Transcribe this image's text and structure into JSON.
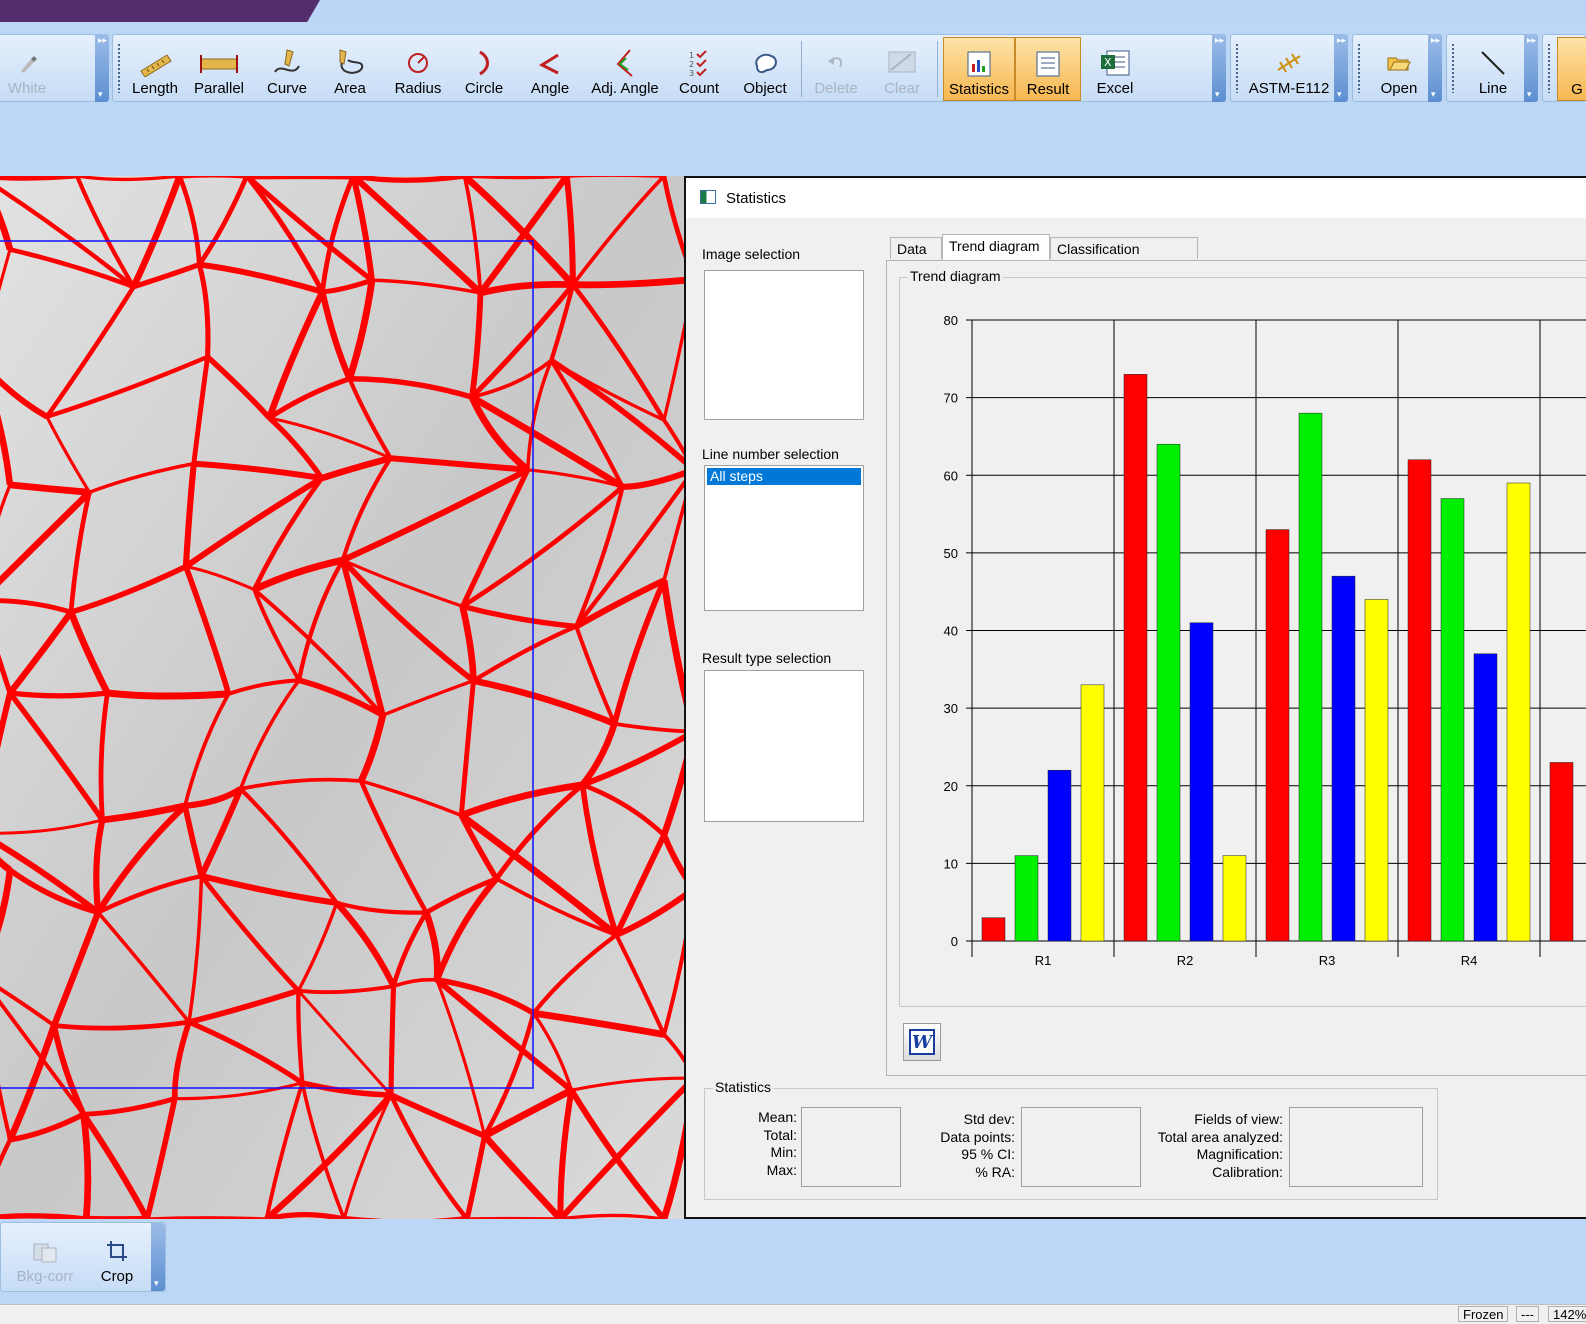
{
  "toolbar": {
    "first_group": {
      "white_label": "White"
    },
    "measure_group": {
      "length": "Length",
      "parallel": "Parallel",
      "curve": "Curve",
      "area": "Area",
      "radius": "Radius",
      "circle": "Circle",
      "angle": "Angle",
      "adj_angle": "Adj. Angle",
      "count": "Count",
      "object": "Object",
      "delete": "Delete",
      "clear": "Clear",
      "statistics": "Statistics",
      "result": "Result",
      "excel": "Excel"
    },
    "astm_label": "ASTM-E112",
    "open_label": "Open",
    "line_label": "Line",
    "partial_label": "G"
  },
  "statistics_window": {
    "title": "Statistics",
    "image_selection_label": "Image selection",
    "line_number_selection_label": "Line number selection",
    "line_number_items": [
      "All steps"
    ],
    "result_type_selection_label": "Result type selection",
    "tabs": [
      "Data",
      "Trend diagram",
      "Classification diagram"
    ],
    "selected_tab": "Trend diagram",
    "trend_group_label": "Trend diagram",
    "stats_group_label": "Statistics",
    "stats_labels_col1": [
      "Mean:",
      "Total:",
      "Min:",
      "Max:"
    ],
    "stats_labels_col2": [
      "Std dev:",
      "Data points:",
      "95 % CI:",
      "% RA:"
    ],
    "stats_labels_col3": [
      "Fields of view:",
      "Total area analyzed:",
      "Magnification:",
      "Calibration:"
    ]
  },
  "chart_data": {
    "type": "bar",
    "categories": [
      "R1",
      "R2",
      "R3",
      "R4",
      ""
    ],
    "series": [
      {
        "color": "#ff0000",
        "values": [
          3,
          73,
          53,
          62,
          23
        ]
      },
      {
        "color": "#00ee00",
        "values": [
          11,
          64,
          68,
          57,
          null
        ]
      },
      {
        "color": "#0000ff",
        "values": [
          22,
          41,
          47,
          37,
          null
        ]
      },
      {
        "color": "#ffff00",
        "values": [
          33,
          11,
          44,
          59,
          null
        ]
      }
    ],
    "ylim": [
      0,
      80
    ],
    "yticks": [
      0,
      10,
      20,
      30,
      40,
      50,
      60,
      70,
      80
    ],
    "grid": true
  },
  "bottom_toolbar": {
    "bkg_corr": "Bkg-corr",
    "crop": "Crop"
  },
  "statusbar": {
    "frozen": "Frozen",
    "dashes": "---",
    "zoom": "142%"
  }
}
